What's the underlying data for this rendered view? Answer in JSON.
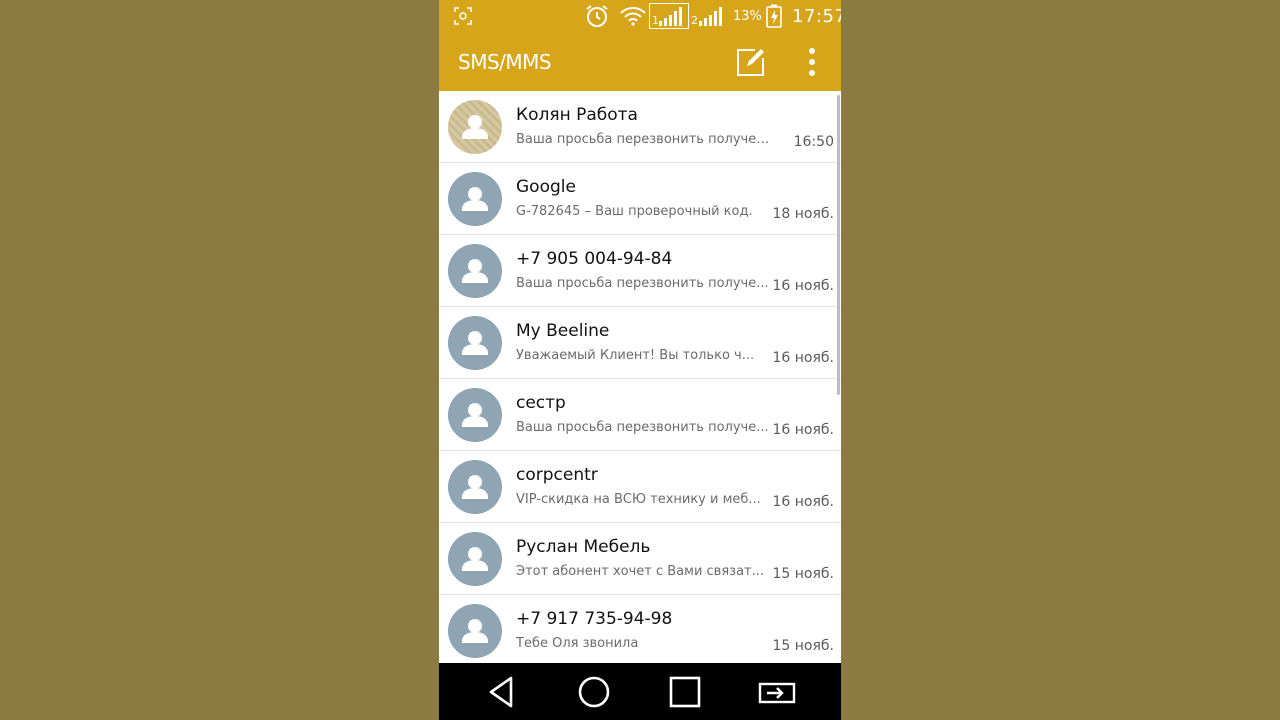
{
  "status_bar": {
    "battery_percent": "13%",
    "time": "17:57"
  },
  "app_bar": {
    "title": "SMS/MMS",
    "compose_icon": "compose-icon",
    "menu_icon": "more-vert-icon"
  },
  "conversations": [
    {
      "name": "Колян Работа",
      "preview": "Ваша просьба перезвонить получена...",
      "time": "16:50",
      "avatar": "gold"
    },
    {
      "name": "Google",
      "preview": "G-782645 – Ваш проверочный код.",
      "time": "18 нояб.",
      "avatar": "gray"
    },
    {
      "name": "+7 905 004-94-84",
      "preview": "Ваша просьба перезвонить получе...",
      "time": "16 нояб.",
      "avatar": "gray"
    },
    {
      "name": "My Beeline",
      "preview": "Уважаемый Клиент! Вы только ч...",
      "time": "16 нояб.",
      "avatar": "gray"
    },
    {
      "name": "сестр",
      "preview": "Ваша просьба перезвонить получе...",
      "time": "16 нояб.",
      "avatar": "gray"
    },
    {
      "name": "corpcentr",
      "preview": "VIP-скидка на ВСЮ технику и меб...",
      "time": "16 нояб.",
      "avatar": "gray"
    },
    {
      "name": "Руслан Мебель",
      "preview": "Этот абонент хочет с Вами связат...",
      "time": "15 нояб.",
      "avatar": "gray"
    },
    {
      "name": "+7 917 735-94-98",
      "preview": "Тебе Оля звонила",
      "time": "15 нояб.",
      "avatar": "gray"
    }
  ],
  "colors": {
    "accent": "#d6a51a",
    "background": "#8b7a42",
    "avatar": "#8fa5b4"
  },
  "nav_bar": {
    "icons": [
      "back-icon",
      "home-icon",
      "recents-icon",
      "dual-window-icon"
    ]
  }
}
